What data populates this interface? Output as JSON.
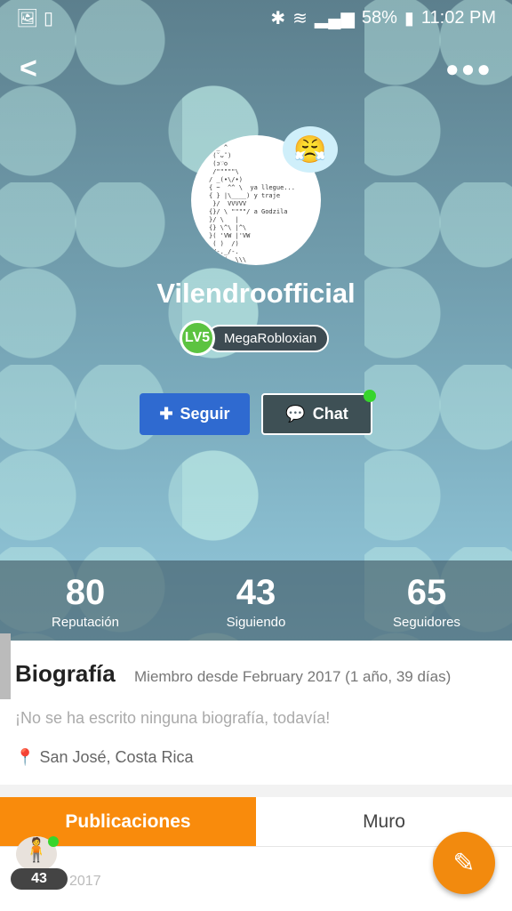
{
  "status_bar": {
    "battery": "58%",
    "time": "11:02 PM",
    "icons": [
      "image-icon",
      "screenshot-icon",
      "bluetooth-icon",
      "wifi-icon",
      "signal-icon",
      "battery-icon"
    ]
  },
  "header": {
    "back_icon": "back-arrow-icon",
    "more_icon": "more-dots-icon"
  },
  "profile": {
    "avatar_text": "  _ ^\n (˘ᴗ˘)\n (ɔ♡o\n /\"\"\"\"\"\\\n/ _(•\\/•)\n{ ~  ^^ \\  ya llegue...\n{ } |\\____) y traje\n }/  VVVVV\n{}/ \\ \"\"\"\"/ a Godzila\n}/ \\   |\n{} \\^\\ |^\\\n}( 'VW |'VW\n ( )  /)\n /-._/-.\n    (__\\\\\\",
    "mood_emoji": "😤",
    "username": "Vilendroofficial",
    "level": "LV5",
    "title": "MegaRobloxian"
  },
  "actions": {
    "follow_label": "Seguir",
    "chat_label": "Chat"
  },
  "stats": [
    {
      "value": "80",
      "label": "Reputación"
    },
    {
      "value": "43",
      "label": "Siguiendo"
    },
    {
      "value": "65",
      "label": "Seguidores"
    }
  ],
  "bio": {
    "heading": "Biografía",
    "member_since": "Miembro desde February 2017 (1 año, 39 días)",
    "empty_text": "¡No se ha escrito ninguna biografía, todavía!",
    "location": "San José, Costa Rica"
  },
  "tabs": [
    {
      "label": "Publicaciones",
      "active": true
    },
    {
      "label": "Muro",
      "active": false
    }
  ],
  "post": {
    "count": "43",
    "date": "2017"
  },
  "colors": {
    "accent": "#f98b0c",
    "follow": "#2f6ad0",
    "online": "#37d52d"
  }
}
